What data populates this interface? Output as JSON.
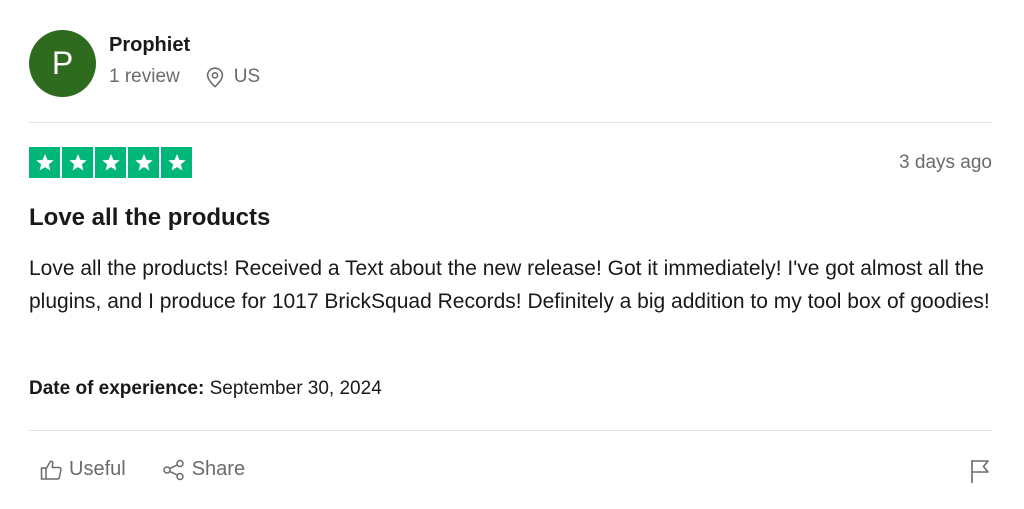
{
  "consumer": {
    "avatar_initial": "P",
    "name": "Prophiet",
    "review_count": "1 review",
    "location": "US"
  },
  "review": {
    "rating": 5,
    "rating_max": 5,
    "star_color": "#00b67a",
    "date_relative": "3 days ago",
    "title": "Love all the products",
    "body": "Love all the products! Received a Text about the new release! Got it immediately! I've got almost all the plugins, and I produce for 1017 BrickSquad Records! Definitely a big addition to my tool box of goodies!",
    "experience_label": "Date of experience:",
    "experience_date": "September 30, 2024"
  },
  "actions": {
    "useful_label": "Useful",
    "share_label": "Share",
    "useful_icon": "thumbs-up-icon",
    "share_icon": "share-icon",
    "report_icon": "flag-icon"
  },
  "colors": {
    "avatar_bg": "#2f6b1f",
    "muted_text": "#6b6b6b",
    "divider": "#e5e5dd"
  }
}
